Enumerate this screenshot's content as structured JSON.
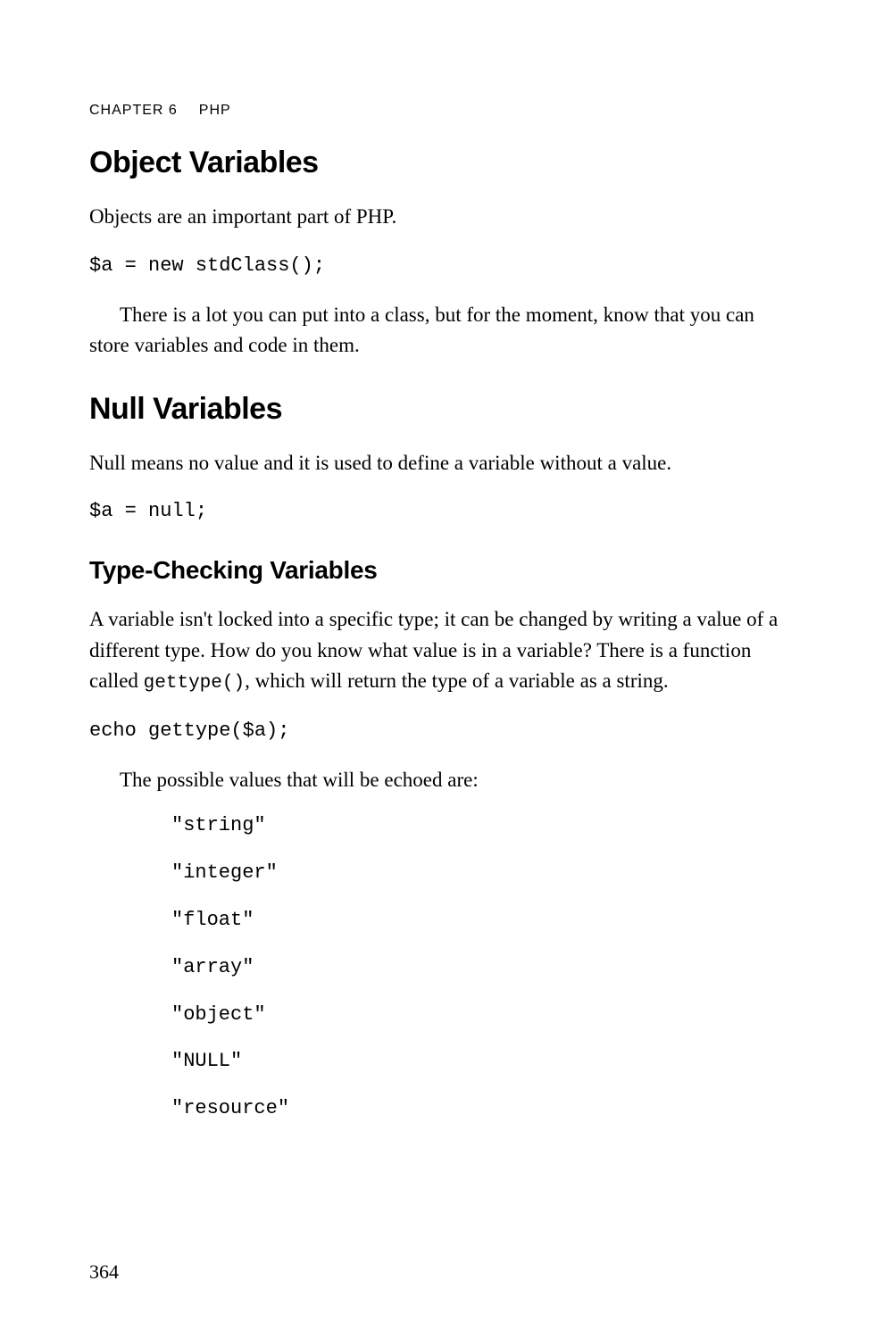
{
  "header": {
    "chapter": "CHAPTER 6",
    "title": "PHP"
  },
  "sections": {
    "object_variables": {
      "heading": "Object Variables",
      "intro": "Objects are an important part of PHP.",
      "code": "$a = new stdClass();",
      "after": "There is a lot you can put into a class, but for the moment, know that you can store variables and code in them."
    },
    "null_variables": {
      "heading": "Null Variables",
      "intro": "Null means no value and it is used to define a variable without a value.",
      "code": "$a = null;"
    },
    "type_checking": {
      "heading": "Type-Checking Variables",
      "body_part1": "A variable isn't locked into a specific type; it can be changed by writing a value of a different type. How do you know what value is in a variable? There is a function called ",
      "inline_code": "gettype()",
      "body_part2": ", which will return the type of a variable as a string.",
      "code": "echo gettype($a);",
      "list_intro": "The possible values that will be echoed are:",
      "types": [
        "\"string\"",
        "\"integer\"",
        "\"float\"",
        "\"array\"",
        "\"object\"",
        "\"NULL\"",
        "\"resource\""
      ]
    }
  },
  "page_number": "364"
}
